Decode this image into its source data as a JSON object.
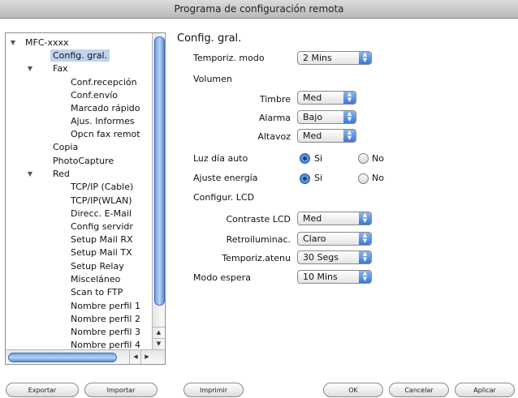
{
  "window": {
    "title": "Programa de configuración remota"
  },
  "tree": [
    {
      "label": "MFC-xxxx",
      "disclosure": "▼"
    },
    {
      "label": "Config. gral.",
      "selected": true
    },
    {
      "label": "Fax",
      "disclosure": "▼"
    },
    {
      "label": "Conf.recepción"
    },
    {
      "label": "Conf.envío"
    },
    {
      "label": "Marcado rápido"
    },
    {
      "label": "Ajus. Informes"
    },
    {
      "label": "Opcn fax remot"
    },
    {
      "label": "Copia"
    },
    {
      "label": "PhotoCapture"
    },
    {
      "label": "Red",
      "disclosure": "▼"
    },
    {
      "label": "TCP/IP (Cable)"
    },
    {
      "label": "TCP/IP(WLAN)"
    },
    {
      "label": "Direcc. E-Mail"
    },
    {
      "label": "Config servidr"
    },
    {
      "label": "Setup Mail RX"
    },
    {
      "label": "Setup Mail TX"
    },
    {
      "label": "Setup Relay"
    },
    {
      "label": "Misceláneo"
    },
    {
      "label": "Scan to FTP"
    },
    {
      "label": "Nombre perfil 1"
    },
    {
      "label": "Nombre perfil 2"
    },
    {
      "label": "Nombre perfil 3"
    },
    {
      "label": "Nombre perfil 4"
    }
  ],
  "pane": {
    "title": "Config. gral.",
    "temporiz_modo": {
      "label": "Temporiz. modo",
      "value": "2 Mins"
    },
    "volumen": {
      "label": "Volumen"
    },
    "timbre": {
      "label": "Timbre",
      "value": "Med"
    },
    "alarma": {
      "label": "Alarma",
      "value": "Bajo"
    },
    "altavoz": {
      "label": "Altavoz",
      "value": "Med"
    },
    "luz_dia": {
      "label": "Luz día auto",
      "opt_si": "Si",
      "opt_no": "No",
      "selected": "Si"
    },
    "ajuste_energia": {
      "label": "Ajuste energía",
      "opt_si": "Si",
      "opt_no": "No",
      "selected": "Si"
    },
    "configur_lcd": {
      "label": "Configur. LCD"
    },
    "contraste": {
      "label": "Contraste LCD",
      "value": "Med"
    },
    "retroilum": {
      "label": "Retroiluminac.",
      "value": "Claro"
    },
    "temporiz_atenu": {
      "label": "Temporiz.atenu",
      "value": "30 Segs"
    },
    "modo_espera": {
      "label": "Modo espera",
      "value": "10 Mins"
    }
  },
  "buttons": {
    "exportar": "Exportar",
    "importar": "Importar",
    "imprimir": "Imprimir",
    "ok": "OK",
    "cancelar": "Cancelar",
    "aplicar": "Aplicar"
  }
}
